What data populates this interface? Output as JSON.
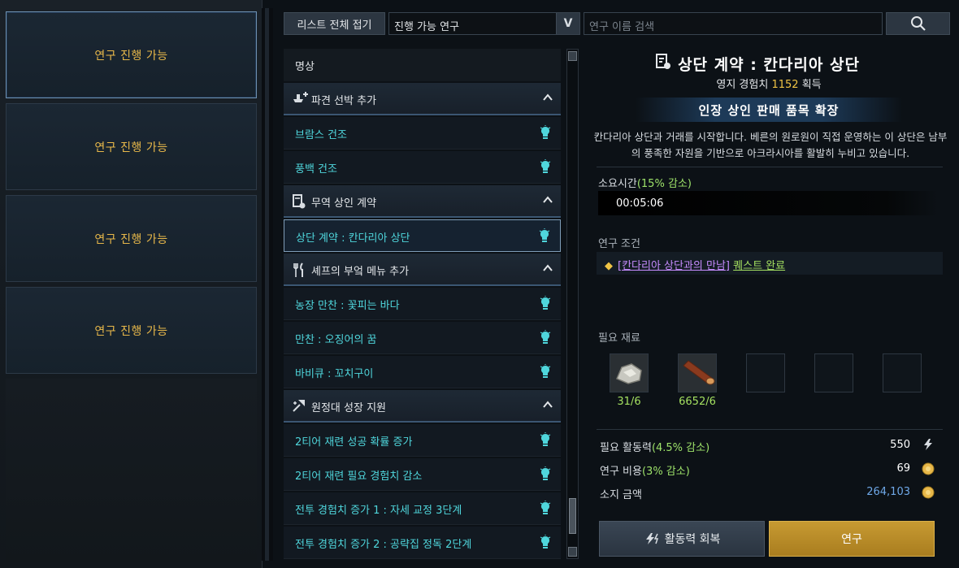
{
  "left_slots": [
    {
      "label": "연구 진행 가능",
      "selected": true
    },
    {
      "label": "연구 진행 가능",
      "selected": false
    },
    {
      "label": "연구 진행 가능",
      "selected": false
    },
    {
      "label": "연구 진행 가능",
      "selected": false
    }
  ],
  "toolbar": {
    "collapse_label": "리스트 전체 접기",
    "filter_value": "진행 가능 연구",
    "filter_arrow": "V",
    "search_placeholder": "연구 이름 검색"
  },
  "list": {
    "header": "명상",
    "rows": [
      {
        "type": "cat",
        "label": "파견 선박 추가",
        "icon": "ship-add-icon"
      },
      {
        "type": "item",
        "label": "브람스 건조"
      },
      {
        "type": "item",
        "label": "풍백 건조"
      },
      {
        "type": "cat",
        "label": "무역 상인 계약",
        "icon": "contract-icon"
      },
      {
        "type": "item",
        "label": "상단 계약 : 칸다리아 상단",
        "selected": true
      },
      {
        "type": "cat",
        "label": "셰프의 부엌 메뉴 추가",
        "icon": "fork-knife-icon"
      },
      {
        "type": "item",
        "label": "농장 만찬 : 꽃피는 바다"
      },
      {
        "type": "item",
        "label": "만찬 : 오징어의 꿈"
      },
      {
        "type": "item",
        "label": "바비큐 : 꼬치구이"
      },
      {
        "type": "cat",
        "label": "원정대 성장 지원",
        "icon": "growth-icon"
      },
      {
        "type": "item",
        "label": "2티어 재련 성공 확률 증가"
      },
      {
        "type": "item",
        "label": "2티어 재련 필요 경험치 감소"
      },
      {
        "type": "item",
        "label": "전투 경험치 증가 1 : 자세 교정 3단계"
      },
      {
        "type": "item",
        "label": "전투 경험치 증가 2 : 공략집 정독 2단계"
      }
    ]
  },
  "detail": {
    "title": "상단 계약 : 칸다리아 상단",
    "exp_prefix": "영지 경험치",
    "exp_value": "1152",
    "exp_suffix": "획득",
    "effect": "인장 상인 판매 품목 확장",
    "description": "칸다리아 상단과 거래를 시작합니다. 베른의 원로원이 직접 운영하는 이 상단은 남부의 풍족한 자원을 기반으로 아크라시아를 활발히 누비고 있습니다.",
    "time_label": "소요시간",
    "time_reduction": "(15% 감소)",
    "time_value": "00:05:06",
    "condition_label": "연구 조건",
    "condition_quest": "[칸다리아 상단과의 만남]",
    "condition_done": "퀘스트 완료",
    "materials_label": "필요 재료",
    "materials": [
      {
        "icon": "ore-icon",
        "count": "31/6"
      },
      {
        "icon": "timber-icon",
        "count": "6652/6"
      }
    ],
    "energy_label": "필요 활동력",
    "energy_reduction": "(4.5% 감소)",
    "energy_value": "550",
    "cost_label": "연구 비용",
    "cost_reduction": "(3% 감소)",
    "cost_value": "69",
    "owned_label": "소지 금액",
    "owned_value": "264,103",
    "recover_button": "활동력 회복",
    "research_button": "연구"
  },
  "colors": {
    "accent_gold": "#e8b84a",
    "item_cyan": "#4fd6dc",
    "green": "#9ee36a"
  }
}
